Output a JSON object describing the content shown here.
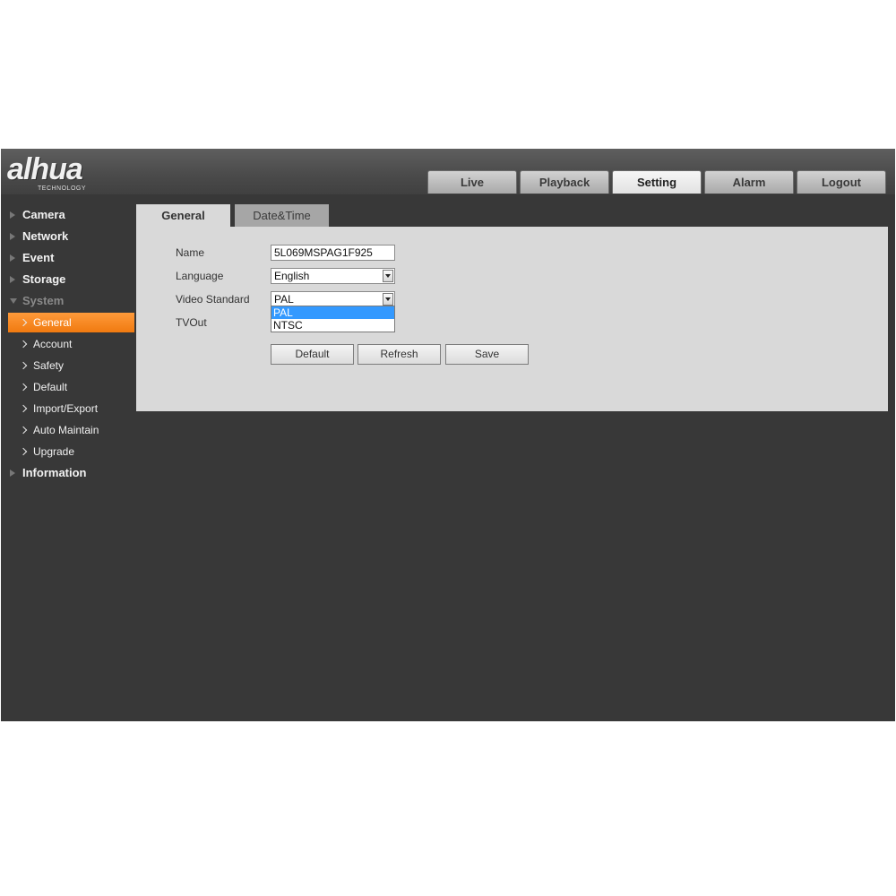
{
  "brand": {
    "logo": "alhua",
    "tagline": "TECHNOLOGY"
  },
  "nav": {
    "tabs": [
      "Live",
      "Playback",
      "Setting",
      "Alarm",
      "Logout"
    ],
    "active": "Setting"
  },
  "sidebar": {
    "categories": {
      "camera": "Camera",
      "network": "Network",
      "event": "Event",
      "storage": "Storage",
      "system": "System",
      "information": "Information"
    },
    "system_items": [
      "General",
      "Account",
      "Safety",
      "Default",
      "Import/Export",
      "Auto Maintain",
      "Upgrade"
    ],
    "active_item": "General"
  },
  "content_tabs": [
    "General",
    "Date&Time"
  ],
  "form": {
    "name_label": "Name",
    "name_value": "5L069MSPAG1F925",
    "language_label": "Language",
    "language_value": "English",
    "video_standard_label": "Video Standard",
    "video_standard_value": "PAL",
    "video_standard_options": [
      "PAL",
      "NTSC"
    ],
    "tvout_label": "TVOut"
  },
  "buttons": {
    "default": "Default",
    "refresh": "Refresh",
    "save": "Save"
  },
  "colors": {
    "accent": "#f58a1f",
    "selection": "#3399ff",
    "background": "#383838",
    "panel": "#d9d9d9"
  }
}
